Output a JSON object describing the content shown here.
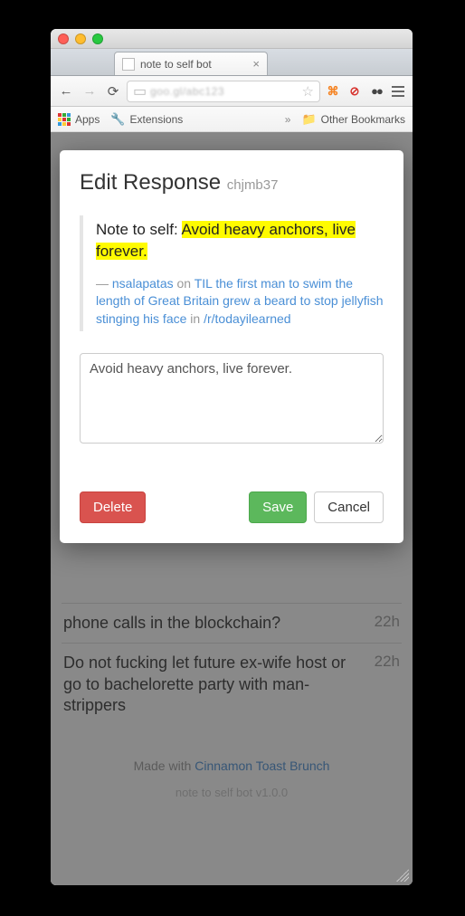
{
  "tab": {
    "title": "note to self bot"
  },
  "bookmarks": {
    "apps": "Apps",
    "extensions": "Extensions",
    "other": "Other Bookmarks"
  },
  "page_rows": [
    {
      "text": "phone calls in the blockchain?",
      "age": "22h"
    },
    {
      "text": "Do not fucking let future ex-wife host or go to bachelorette party with man-strippers",
      "age": "22h"
    }
  ],
  "footer": {
    "prefix": "Made with ",
    "link": "Cinnamon Toast Brunch",
    "version": "note to self bot v1.0.0"
  },
  "modal": {
    "title": "Edit Response",
    "id": "chjmb37",
    "note_prefix": "Note to self: ",
    "note_highlight": "Avoid heavy anchors, live forever.",
    "meta_dash": "— ",
    "author": "nsalapatas",
    "meta_on": " on ",
    "thread": "TIL the first man to swim the length of Great Britain grew a beard to stop jellyfish stinging his face",
    "meta_in": " in ",
    "subreddit": "/r/todayilearned",
    "textarea_value": "Avoid heavy anchors, live forever.",
    "delete": "Delete",
    "save": "Save",
    "cancel": "Cancel"
  }
}
